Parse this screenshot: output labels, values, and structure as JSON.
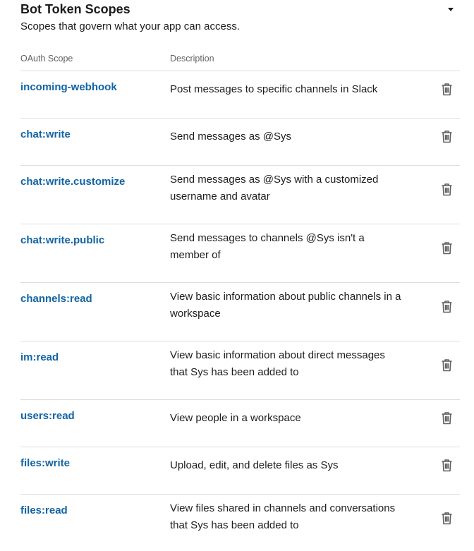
{
  "section": {
    "title": "Bot Token Scopes",
    "subtitle": "Scopes that govern what your app can access.",
    "toggle_icon": "caret-down-icon"
  },
  "table": {
    "columns": {
      "scope": "OAuth Scope",
      "description": "Description"
    },
    "rows": [
      {
        "scope": "incoming-webhook",
        "description": "Post messages to specific channels in Slack"
      },
      {
        "scope": "chat:write",
        "description": "Send messages as @Sys"
      },
      {
        "scope": "chat:write.customize",
        "description": "Send messages as @Sys with a customized username and avatar"
      },
      {
        "scope": "chat:write.public",
        "description": "Send messages to channels @Sys isn't a member of"
      },
      {
        "scope": "channels:read",
        "description": "View basic information about public channels in a workspace"
      },
      {
        "scope": "im:read",
        "description": "View basic information about direct messages that Sys has been added to"
      },
      {
        "scope": "users:read",
        "description": "View people in a workspace"
      },
      {
        "scope": "files:write",
        "description": "Upload, edit, and delete files as Sys"
      },
      {
        "scope": "files:read",
        "description": "View files shared in channels and conversations that Sys has been added to"
      }
    ],
    "row_action_icon": "trash-icon"
  },
  "colors": {
    "link": "#1264a3",
    "text": "#1d1c1d",
    "muted": "#616061",
    "divider": "#dddddd"
  }
}
